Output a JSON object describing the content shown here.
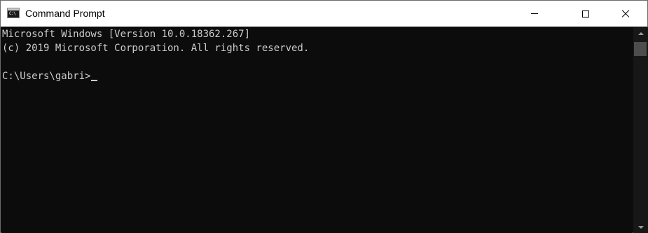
{
  "window": {
    "title": "Command Prompt",
    "icon": "command-prompt-icon",
    "icon_glyph": "C:\\"
  },
  "caption_buttons": {
    "minimize": "minimize-icon",
    "maximize": "maximize-icon",
    "close": "close-icon"
  },
  "console": {
    "lines": [
      "Microsoft Windows [Version 10.0.18362.267]",
      "(c) 2019 Microsoft Corporation. All rights reserved.",
      "",
      "C:\\Users\\gabri>"
    ]
  },
  "colors": {
    "console_background": "#0c0c0c",
    "console_text": "#cccccc",
    "titlebar_background": "#ffffff",
    "scrollbar_track": "#171717",
    "scrollbar_thumb": "#4d4d4d"
  }
}
